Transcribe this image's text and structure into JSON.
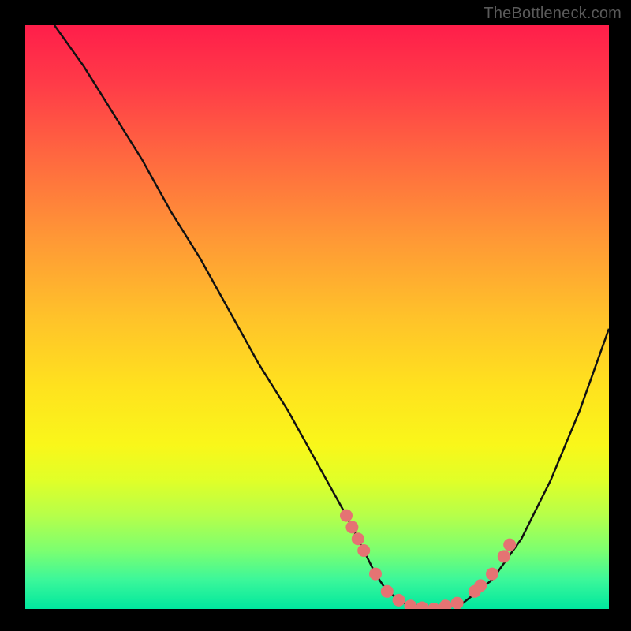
{
  "watermark": "TheBottleneck.com",
  "chart_data": {
    "type": "line",
    "title": "",
    "xlabel": "",
    "ylabel": "",
    "xlim": [
      0,
      100
    ],
    "ylim": [
      0,
      100
    ],
    "grid": false,
    "series": [
      {
        "name": "curve",
        "x": [
          5,
          10,
          15,
          20,
          25,
          30,
          35,
          40,
          45,
          50,
          55,
          58,
          60,
          62,
          65,
          70,
          75,
          80,
          85,
          90,
          95,
          100
        ],
        "y": [
          100,
          93,
          85,
          77,
          68,
          60,
          51,
          42,
          34,
          25,
          16,
          10,
          6,
          3,
          1,
          0,
          1,
          5,
          12,
          22,
          34,
          48
        ],
        "stroke": "#000000",
        "stroke_width": 2
      }
    ],
    "markers": [
      {
        "name": "left-cluster",
        "x": [
          55,
          56,
          57,
          58,
          60
        ],
        "y": [
          16,
          14,
          12,
          10,
          6
        ]
      },
      {
        "name": "valley-cluster",
        "x": [
          62,
          64,
          66,
          68,
          70,
          72,
          74
        ],
        "y": [
          3,
          1.5,
          0.5,
          0.2,
          0,
          0.5,
          1
        ]
      },
      {
        "name": "right-cluster",
        "x": [
          77,
          78,
          80,
          82,
          83
        ],
        "y": [
          3,
          4,
          6,
          9,
          11
        ]
      }
    ],
    "marker_style": {
      "fill": "#e57373",
      "radius_px": 8
    },
    "background_gradient": {
      "stops": [
        {
          "pct": 0,
          "color": "#ff1e4a"
        },
        {
          "pct": 50,
          "color": "#ffc22a"
        },
        {
          "pct": 78,
          "color": "#e0ff28"
        },
        {
          "pct": 100,
          "color": "#00e89e"
        }
      ]
    }
  }
}
